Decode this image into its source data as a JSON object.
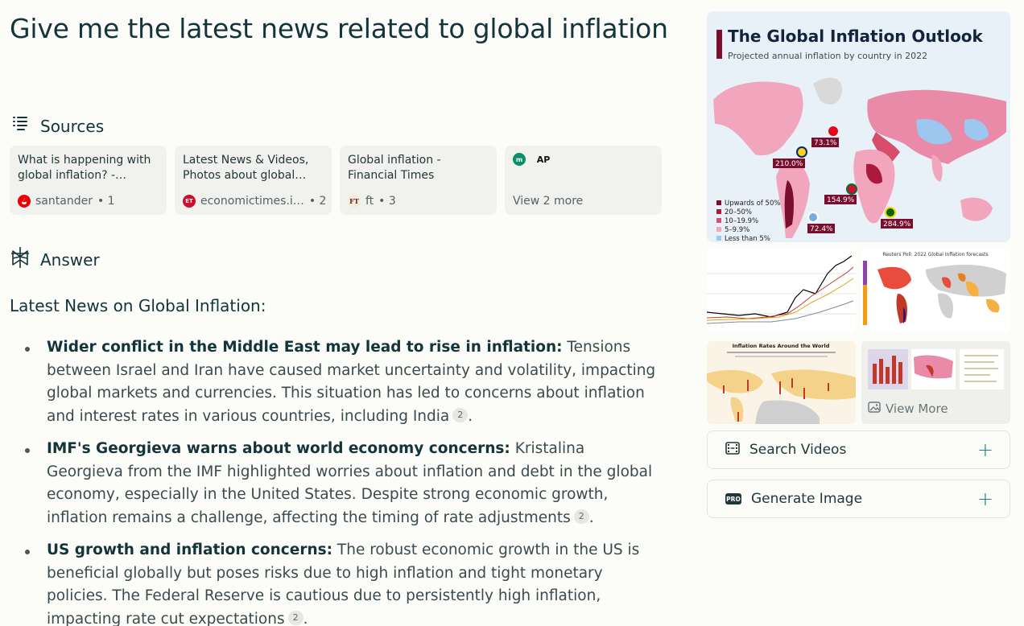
{
  "query": "Give me the latest news related to global inflation",
  "sources": {
    "heading": "Sources",
    "cards": [
      {
        "title": "What is happening with global inflation? -…",
        "site": "santander",
        "num": "• 1"
      },
      {
        "title": "Latest News & Videos, Photos about global…",
        "site": "economictimes.i…",
        "num": "• 2"
      },
      {
        "title": "Global inflation - Financial Times",
        "site": "ft",
        "num": "• 3"
      },
      {
        "title": "",
        "site": "",
        "num": ""
      }
    ],
    "more_label": "View 2 more"
  },
  "answer": {
    "heading": "Answer",
    "title": "Latest News on Global Inflation:",
    "items": [
      {
        "bold": "Wider conflict in the Middle East may lead to rise in inflation:",
        "text": " Tensions between Israel and Iran have caused market uncertainty and volatility, impacting global markets and currencies. This situation has led to concerns about inflation and interest rates in various countries, including India",
        "cite": "2",
        "end": "."
      },
      {
        "bold": "IMF's Georgieva warns about world economy concerns:",
        "text": " Kristalina Georgieva from the IMF highlighted worries about inflation and debt in the global economy, especially in the United States. Despite strong economic growth, inflation remains a challenge, affecting the timing of rate adjustments",
        "cite": "2",
        "end": "."
      },
      {
        "bold": "US growth and inflation concerns:",
        "text": " The robust economic growth in the US is beneficial globally but poses risks due to high inflation and tight monetary policies. The Federal Reserve is cautious due to persistently high inflation, impacting rate cut expectations",
        "cite": "2",
        "end": "."
      }
    ]
  },
  "media": {
    "hero": {
      "title": "The Global Inflation Outlook",
      "subtitle": "Projected annual inflation by country in 2022",
      "legend": [
        "Upwards of 50%",
        "20–50%",
        "10–19.9%",
        "5–9.9%",
        "Less than 5%"
      ],
      "labels": [
        "73.1%",
        "210.0%",
        "154.9%",
        "284.9%",
        "72.4%"
      ]
    },
    "thumb2_caption": "Reuters Poll: 2022 Global Inflation forecasts",
    "thumb3_caption": "Inflation Rates Around the World",
    "view_more": "View More"
  },
  "actions": {
    "search_videos": "Search Videos",
    "generate_image": "Generate Image",
    "pro_badge": "PRO"
  },
  "colors": {
    "accent": "#1f7f89",
    "background": "#fcfcf9",
    "map_dark": "#7a0e2e",
    "map_pink": "#f2a6be",
    "map_blue": "#9cc7ef"
  }
}
